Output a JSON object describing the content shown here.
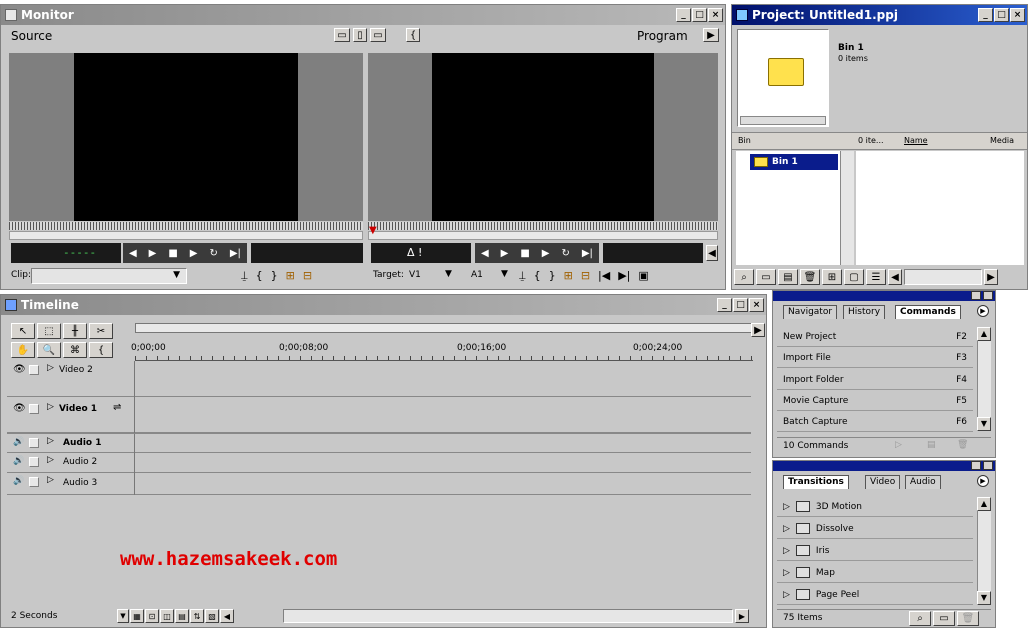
{
  "monitor": {
    "title": "Monitor",
    "source_label": "Source",
    "program_label": "Program",
    "source_timecode": "-----",
    "delta_symbol": "Δ !",
    "clip_label": "Clip:",
    "target_label": "Target:",
    "target_video": "V1",
    "target_audio": "A1"
  },
  "project": {
    "title": "Project: Untitled1.ppj",
    "bin_name": "Bin 1",
    "bin_items": "0 items",
    "columns": [
      "Bin",
      "0 ite...",
      "Name",
      "Media"
    ],
    "tree_item": "Bin 1"
  },
  "timeline": {
    "title": "Timeline",
    "timecodes": [
      "0;00;00",
      "0;00;08;00",
      "0;00;16;00",
      "0;00;24;00"
    ],
    "tracks": [
      {
        "name": "Video 2",
        "bold": false
      },
      {
        "name": "Video 1",
        "bold": true
      },
      {
        "name": "Audio 1",
        "bold": true
      },
      {
        "name": "Audio 2",
        "bold": false
      },
      {
        "name": "Audio 3",
        "bold": false
      }
    ],
    "zoom_label": "2 Seconds",
    "watermark": "www.hazemsakeek.com"
  },
  "commands_panel": {
    "tabs": [
      "Navigator",
      "History",
      "Commands"
    ],
    "active_tab": "Commands",
    "items": [
      {
        "label": "New Project",
        "key": "F2"
      },
      {
        "label": "Import File",
        "key": "F3"
      },
      {
        "label": "Import Folder",
        "key": "F4"
      },
      {
        "label": "Movie Capture",
        "key": "F5"
      },
      {
        "label": "Batch Capture",
        "key": "F6"
      }
    ],
    "count": "10 Commands"
  },
  "transitions_panel": {
    "tabs": [
      "Transitions",
      "Video",
      "Audio"
    ],
    "active_tab": "Transitions",
    "items": [
      "3D Motion",
      "Dissolve",
      "Iris",
      "Map",
      "Page Peel"
    ],
    "count": "75 Items"
  },
  "colors": {
    "active_title": "#00106b",
    "inactive_title": "#8a8a8a",
    "watermark": "#e00000",
    "folder": "#ffe14d"
  }
}
